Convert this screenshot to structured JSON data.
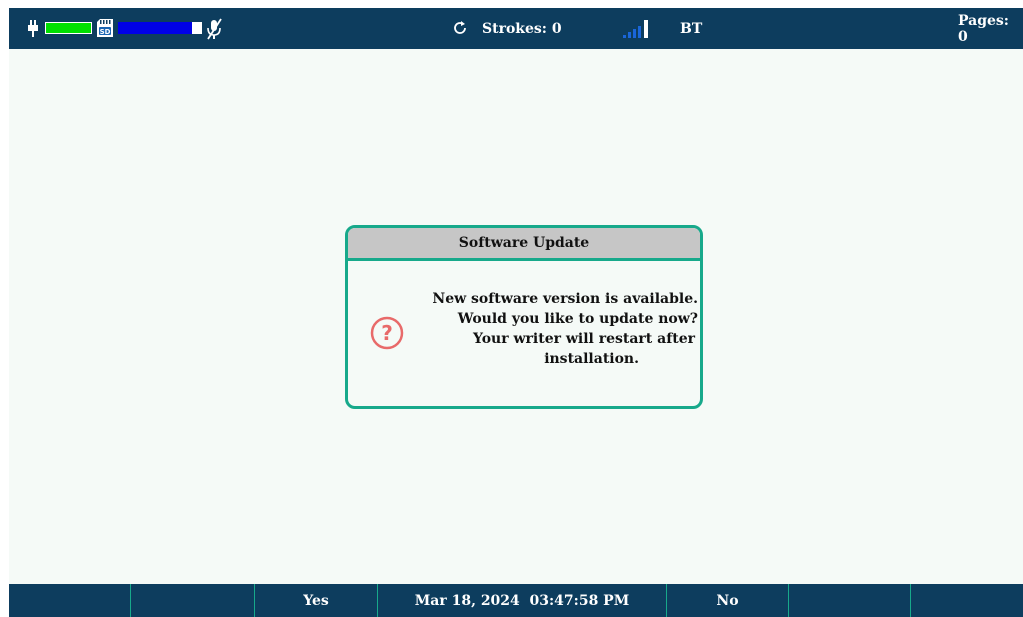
{
  "topbar": {
    "strokes_label": "Strokes: 0",
    "bt_label": "BT",
    "pages_label": "Pages: 0",
    "battery_level": 1.0,
    "storage_level": 0.88
  },
  "dialog": {
    "title": "Software Update",
    "line1": "New software version is available.",
    "line2": "Would you like to update now?",
    "line3": "Your writer will restart after",
    "line4": "installation."
  },
  "bottombar": {
    "yes_label": "Yes",
    "datetime": "Mar 18, 2024  03:47:58 PM",
    "no_label": "No"
  },
  "colors": {
    "bar_bg": "#0d3d5e",
    "accent": "#17a98b",
    "battery": "#00e000",
    "storage": "#0000e6",
    "question": "#e86a6a"
  }
}
